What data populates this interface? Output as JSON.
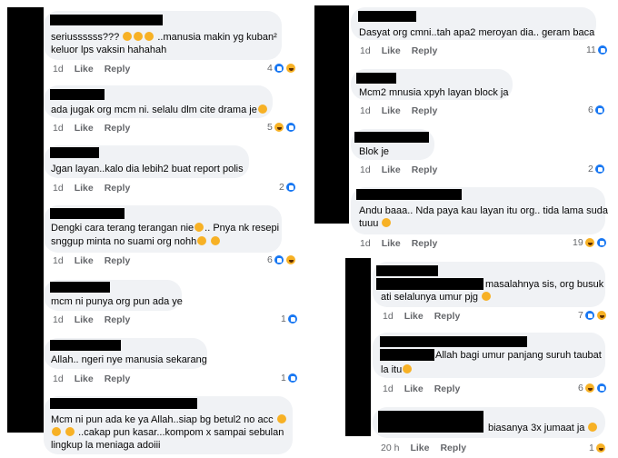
{
  "actions": {
    "like": "Like",
    "reply": "Reply"
  },
  "comments": [
    {
      "line1": "seriussssss???",
      "line1b": "..manusia makin yg kuban²",
      "line2": "keluor lps vaksin hahahah",
      "time": "1d",
      "count": "4"
    },
    {
      "line1": "ada jugak org mcm ni. selalu dlm cite drama je",
      "time": "1d",
      "count": "5"
    },
    {
      "line1": "Jgan layan..kalo dia lebih2 buat report polis",
      "time": "1d",
      "count": "2"
    },
    {
      "line1": "Dengki cara terang terangan nie",
      "line1b": ".. Pnya nk resepi",
      "line2": "snggup minta no suami org nohh",
      "time": "1d",
      "count": "6"
    },
    {
      "line1": "mcm ni punya org pun ada ye",
      "time": "1d",
      "count": "1"
    },
    {
      "line1": "Allah.. ngeri nye manusia sekarang",
      "time": "1d",
      "count": "1"
    },
    {
      "line1": "Mcm ni pun ada ke ya Allah..siap bg betul2 no acc",
      "line2": "..cakap pun kasar...kompom x sampai sebulan",
      "line3": "lingkup la meniaga adoiii"
    },
    {
      "line1": "Dasyat org cmni..tah apa2 meroyan dia.. geram baca",
      "time": "1d",
      "count": "11"
    },
    {
      "line1": "Mcm2 mnusia xpyh layan block ja",
      "time": "1d",
      "count": "6"
    },
    {
      "line1": "Blok je",
      "time": "1d",
      "count": "2"
    },
    {
      "line1": "Andu baaa.. Nda paya kau layan itu org.. tida lama suda",
      "line2": "tuuu",
      "time": "1d",
      "count": "19"
    },
    {
      "line1": "masalahnya sis, org busuk",
      "line2": "ati selalunya umur pjg",
      "time": "1d",
      "count": "7"
    },
    {
      "line1": "Allah bagi umur panjang suruh taubat",
      "line2": "la itu",
      "time": "1d",
      "count": "6"
    },
    {
      "line1": "biasanya 3x jumaat ja",
      "time": "20 h",
      "count": "1"
    }
  ]
}
